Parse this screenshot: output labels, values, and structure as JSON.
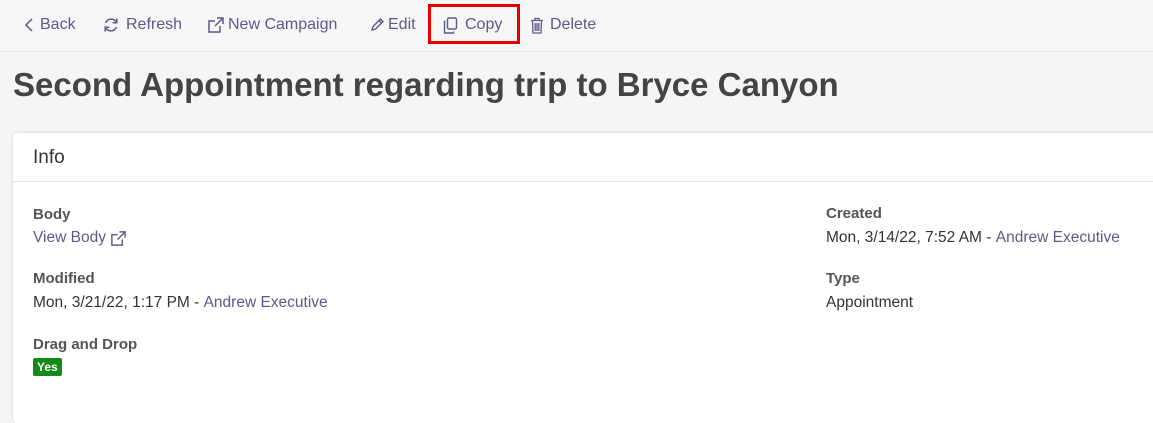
{
  "toolbar": {
    "back_label": "Back",
    "refresh_label": "Refresh",
    "new_campaign_label": "New Campaign",
    "edit_label": "Edit",
    "copy_label": "Copy",
    "delete_label": "Delete"
  },
  "page": {
    "title": "Second Appointment regarding trip to Bryce Canyon"
  },
  "info": {
    "header": "Info",
    "body_label": "Body",
    "view_body_link": "View Body",
    "modified_label": "Modified",
    "modified_date": "Mon, 3/21/22, 1:17 PM - ",
    "modified_user": "Andrew Executive",
    "drag_drop_label": "Drag and Drop",
    "drag_drop_value": "Yes",
    "created_label": "Created",
    "created_date": "Mon, 3/14/22, 7:52 AM - ",
    "created_user": "Andrew Executive",
    "type_label": "Type",
    "type_value": "Appointment"
  },
  "colors": {
    "link": "#5b5a8a",
    "highlight": "#e60000",
    "badge": "#168a16"
  }
}
